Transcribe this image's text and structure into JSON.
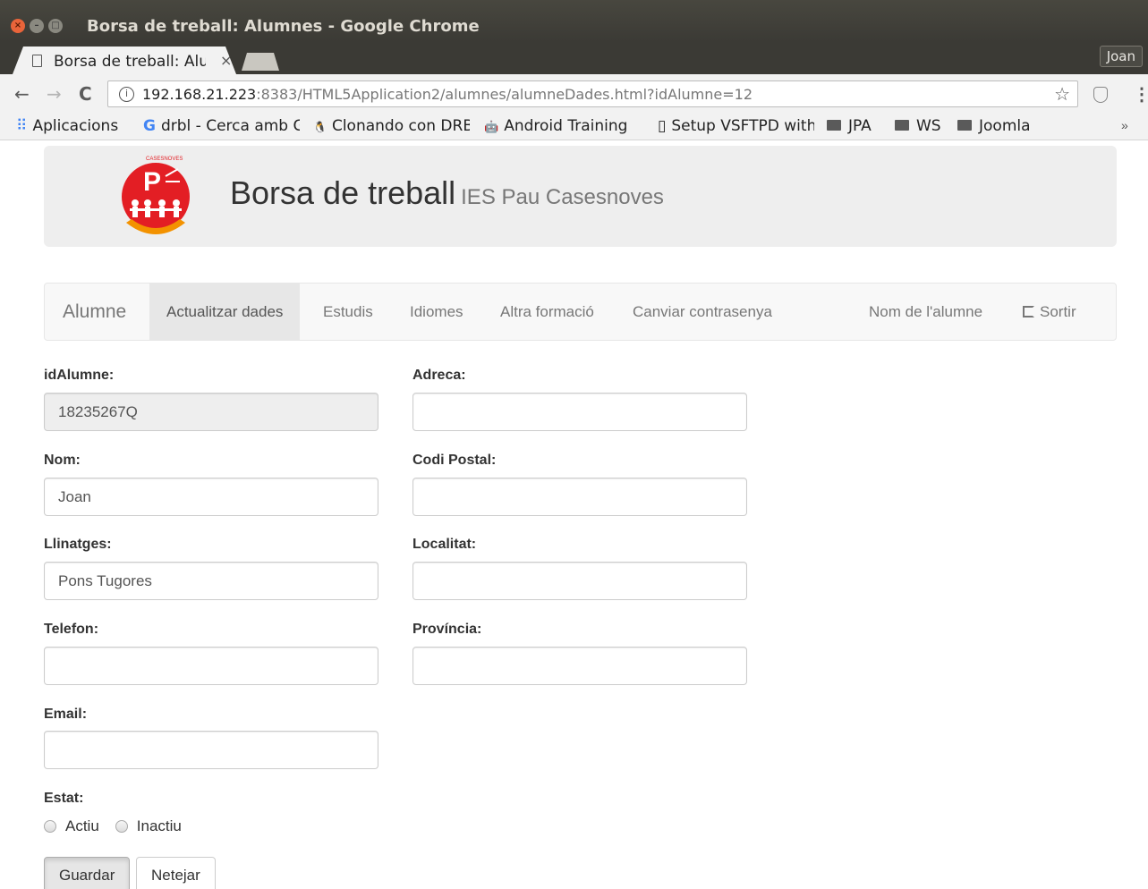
{
  "window": {
    "title": "Borsa de treball: Alumnes - Google Chrome",
    "close_glyph": "×",
    "min_glyph": "–",
    "max_glyph": "□"
  },
  "tab": {
    "title": "Borsa de treball: Alumnes",
    "close_glyph": "×"
  },
  "profile": {
    "name": "Joan"
  },
  "toolbar": {
    "back_glyph": "←",
    "forward_glyph": "→",
    "reload_glyph": "C",
    "info_glyph": "i",
    "url_host": "192.168.21.223",
    "url_rest": ":8383/HTML5Application2/alumnes/alumneDades.html?idAlumne=12",
    "star_glyph": "☆",
    "menu_glyph": "⋮"
  },
  "bookmarks": {
    "items": [
      {
        "icon": "apps-grid-icon",
        "glyph": "⠿",
        "label": "Aplicacions"
      },
      {
        "icon": "google-icon",
        "glyph": "G",
        "label": "drbl - Cerca amb Google"
      },
      {
        "icon": "drbl-icon",
        "glyph": "🐧",
        "label": "Clonando con DRBL"
      },
      {
        "icon": "android-icon",
        "glyph": "🤖",
        "label": "Android Training"
      },
      {
        "icon": "page-icon",
        "glyph": "▯",
        "label": "Setup VSFTPD with"
      },
      {
        "icon": "folder-icon",
        "label": "JPA"
      },
      {
        "icon": "folder-icon",
        "label": "WS"
      },
      {
        "icon": "folder-icon",
        "label": "Joomla"
      }
    ],
    "more_glyph": "»"
  },
  "header": {
    "title": "Borsa de treball",
    "subtitle": "IES Pau Casesnoves",
    "logo_letter": "P",
    "logo_text": "CASESNOVES"
  },
  "nav": {
    "brand": "Alumne",
    "items": [
      "Actualitzar dades",
      "Estudis",
      "Idiomes",
      "Altra formació",
      "Canviar contrasenya"
    ],
    "user": "Nom de l'alumne",
    "logout": "Sortir"
  },
  "form": {
    "fields": [
      {
        "label": "idAlumne:",
        "value": "18235267Q"
      },
      {
        "label": "Nom:",
        "value": "Joan"
      },
      {
        "label": "Llinatges:",
        "value": "Pons Tugores"
      },
      {
        "label": "Telefon:",
        "value": ""
      },
      {
        "label": "Email:",
        "value": ""
      },
      {
        "label": "Adreca:",
        "value": ""
      },
      {
        "label": "Codi Postal:",
        "value": ""
      },
      {
        "label": "Localitat:",
        "value": ""
      },
      {
        "label": "Província:",
        "value": ""
      }
    ],
    "estat_label": "Estat:",
    "estat_options": [
      "Actiu",
      "Inactiu"
    ],
    "save_label": "Guardar",
    "clear_label": "Netejar"
  },
  "colors": {
    "logo_red": "#e31e24",
    "logo_orange": "#f39200",
    "nav_active_bg": "#e7e7e7"
  }
}
